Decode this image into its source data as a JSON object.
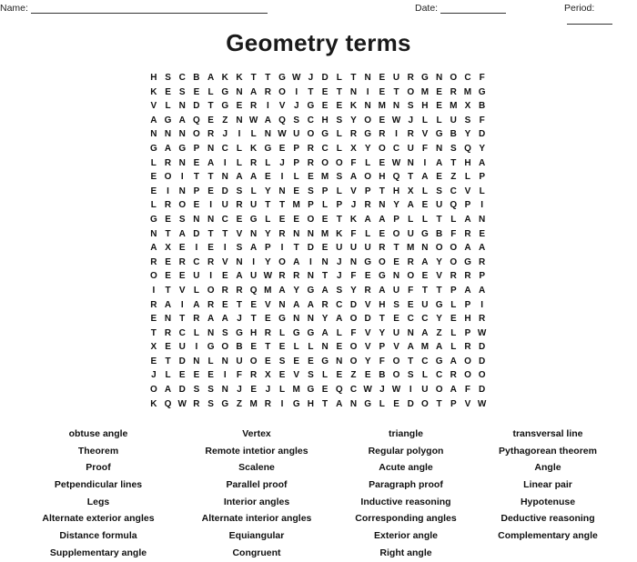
{
  "header": {
    "name_label": "Name:",
    "date_label": "Date:",
    "period_label": "Period:"
  },
  "title": "Geometry terms",
  "grid": [
    "HSCBAKKTTGWJDLTNEURGNOCF",
    "KESELGNAROITETNIETOMERMG",
    "VLNDTGERIVJGEEKNMNSHEMXB",
    "AGAQEZNWAQSCHSYOEWJLLUSF",
    "NNNORJILNWUOGLRGRIRVGBYD",
    "GAGPNCLKGEPRCLXYOCUFNSQY",
    "LRNEAILRLJPROOFLEWNIATHA",
    "EOITTNAAEILEMSAOHQTAEZLP",
    "EINPEDSLYNESPLVPTHXLSCVL",
    "LROEIURUTTMPLPJRNYAEUQPI",
    "GESNNCEGLEEOETKAAPLLTLAN",
    "NTADTTVNYRNNMKFLEOUGBFRE",
    "AXEIEISAPITDEUUURTMNOOAA",
    "RERCRVNIYOAINJNGOERAYOGR",
    "OEEUIEAUWRRNTJFEGNOEVRRP",
    "ITVLORRQMAYGASYRAUFTTPAA",
    "RAIARETEVNAARCDVHSEUGLPI",
    "ENTRAAJTEGNNYAODTECCYEHR",
    "TRCLNSGHRLGGALFVYUNAZLPW",
    "XEUIGOBETELLNEOVPVAMALRD",
    "ETDNLNUOESEEGNOYFOTCGAOD",
    "JLEEEIFRXEVSLEZEBOSLCROO",
    "OADSSNJEJLMGEQCWJWIUOAFD",
    "KQWRSGZMRIGHTANGLEDOTPVW"
  ],
  "word_columns": [
    [
      "obtuse angle",
      "Theorem",
      "Proof",
      "Petpendicular lines",
      "Legs",
      "Alternate exterior angles",
      "Distance formula",
      "Supplementary angle"
    ],
    [
      "Vertex",
      "Remote intetior angles",
      "Scalene",
      "Parallel proof",
      "Interior angles",
      "Alternate interior angles",
      "Equiangular",
      "Congruent"
    ],
    [
      "triangle",
      "Regular polygon",
      "Acute angle",
      "Paragraph proof",
      "Inductive reasoning",
      "Corresponding angles",
      "Exterior angle",
      "Right angle"
    ],
    [
      "transversal line",
      "Pythagorean theorem",
      "Angle",
      "Linear pair",
      "Hypotenuse",
      "Deductive reasoning",
      "Complementary angle"
    ]
  ]
}
